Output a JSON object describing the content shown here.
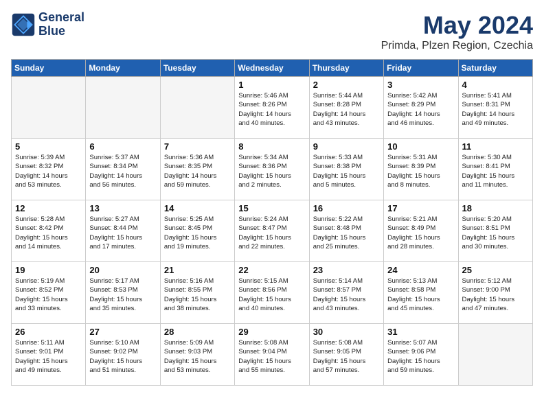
{
  "header": {
    "logo_line1": "General",
    "logo_line2": "Blue",
    "month_year": "May 2024",
    "location": "Primda, Plzen Region, Czechia"
  },
  "weekdays": [
    "Sunday",
    "Monday",
    "Tuesday",
    "Wednesday",
    "Thursday",
    "Friday",
    "Saturday"
  ],
  "weeks": [
    [
      {
        "day": "",
        "info": ""
      },
      {
        "day": "",
        "info": ""
      },
      {
        "day": "",
        "info": ""
      },
      {
        "day": "1",
        "info": "Sunrise: 5:46 AM\nSunset: 8:26 PM\nDaylight: 14 hours\nand 40 minutes."
      },
      {
        "day": "2",
        "info": "Sunrise: 5:44 AM\nSunset: 8:28 PM\nDaylight: 14 hours\nand 43 minutes."
      },
      {
        "day": "3",
        "info": "Sunrise: 5:42 AM\nSunset: 8:29 PM\nDaylight: 14 hours\nand 46 minutes."
      },
      {
        "day": "4",
        "info": "Sunrise: 5:41 AM\nSunset: 8:31 PM\nDaylight: 14 hours\nand 49 minutes."
      }
    ],
    [
      {
        "day": "5",
        "info": "Sunrise: 5:39 AM\nSunset: 8:32 PM\nDaylight: 14 hours\nand 53 minutes."
      },
      {
        "day": "6",
        "info": "Sunrise: 5:37 AM\nSunset: 8:34 PM\nDaylight: 14 hours\nand 56 minutes."
      },
      {
        "day": "7",
        "info": "Sunrise: 5:36 AM\nSunset: 8:35 PM\nDaylight: 14 hours\nand 59 minutes."
      },
      {
        "day": "8",
        "info": "Sunrise: 5:34 AM\nSunset: 8:36 PM\nDaylight: 15 hours\nand 2 minutes."
      },
      {
        "day": "9",
        "info": "Sunrise: 5:33 AM\nSunset: 8:38 PM\nDaylight: 15 hours\nand 5 minutes."
      },
      {
        "day": "10",
        "info": "Sunrise: 5:31 AM\nSunset: 8:39 PM\nDaylight: 15 hours\nand 8 minutes."
      },
      {
        "day": "11",
        "info": "Sunrise: 5:30 AM\nSunset: 8:41 PM\nDaylight: 15 hours\nand 11 minutes."
      }
    ],
    [
      {
        "day": "12",
        "info": "Sunrise: 5:28 AM\nSunset: 8:42 PM\nDaylight: 15 hours\nand 14 minutes."
      },
      {
        "day": "13",
        "info": "Sunrise: 5:27 AM\nSunset: 8:44 PM\nDaylight: 15 hours\nand 17 minutes."
      },
      {
        "day": "14",
        "info": "Sunrise: 5:25 AM\nSunset: 8:45 PM\nDaylight: 15 hours\nand 19 minutes."
      },
      {
        "day": "15",
        "info": "Sunrise: 5:24 AM\nSunset: 8:47 PM\nDaylight: 15 hours\nand 22 minutes."
      },
      {
        "day": "16",
        "info": "Sunrise: 5:22 AM\nSunset: 8:48 PM\nDaylight: 15 hours\nand 25 minutes."
      },
      {
        "day": "17",
        "info": "Sunrise: 5:21 AM\nSunset: 8:49 PM\nDaylight: 15 hours\nand 28 minutes."
      },
      {
        "day": "18",
        "info": "Sunrise: 5:20 AM\nSunset: 8:51 PM\nDaylight: 15 hours\nand 30 minutes."
      }
    ],
    [
      {
        "day": "19",
        "info": "Sunrise: 5:19 AM\nSunset: 8:52 PM\nDaylight: 15 hours\nand 33 minutes."
      },
      {
        "day": "20",
        "info": "Sunrise: 5:17 AM\nSunset: 8:53 PM\nDaylight: 15 hours\nand 35 minutes."
      },
      {
        "day": "21",
        "info": "Sunrise: 5:16 AM\nSunset: 8:55 PM\nDaylight: 15 hours\nand 38 minutes."
      },
      {
        "day": "22",
        "info": "Sunrise: 5:15 AM\nSunset: 8:56 PM\nDaylight: 15 hours\nand 40 minutes."
      },
      {
        "day": "23",
        "info": "Sunrise: 5:14 AM\nSunset: 8:57 PM\nDaylight: 15 hours\nand 43 minutes."
      },
      {
        "day": "24",
        "info": "Sunrise: 5:13 AM\nSunset: 8:58 PM\nDaylight: 15 hours\nand 45 minutes."
      },
      {
        "day": "25",
        "info": "Sunrise: 5:12 AM\nSunset: 9:00 PM\nDaylight: 15 hours\nand 47 minutes."
      }
    ],
    [
      {
        "day": "26",
        "info": "Sunrise: 5:11 AM\nSunset: 9:01 PM\nDaylight: 15 hours\nand 49 minutes."
      },
      {
        "day": "27",
        "info": "Sunrise: 5:10 AM\nSunset: 9:02 PM\nDaylight: 15 hours\nand 51 minutes."
      },
      {
        "day": "28",
        "info": "Sunrise: 5:09 AM\nSunset: 9:03 PM\nDaylight: 15 hours\nand 53 minutes."
      },
      {
        "day": "29",
        "info": "Sunrise: 5:08 AM\nSunset: 9:04 PM\nDaylight: 15 hours\nand 55 minutes."
      },
      {
        "day": "30",
        "info": "Sunrise: 5:08 AM\nSunset: 9:05 PM\nDaylight: 15 hours\nand 57 minutes."
      },
      {
        "day": "31",
        "info": "Sunrise: 5:07 AM\nSunset: 9:06 PM\nDaylight: 15 hours\nand 59 minutes."
      },
      {
        "day": "",
        "info": ""
      }
    ]
  ]
}
